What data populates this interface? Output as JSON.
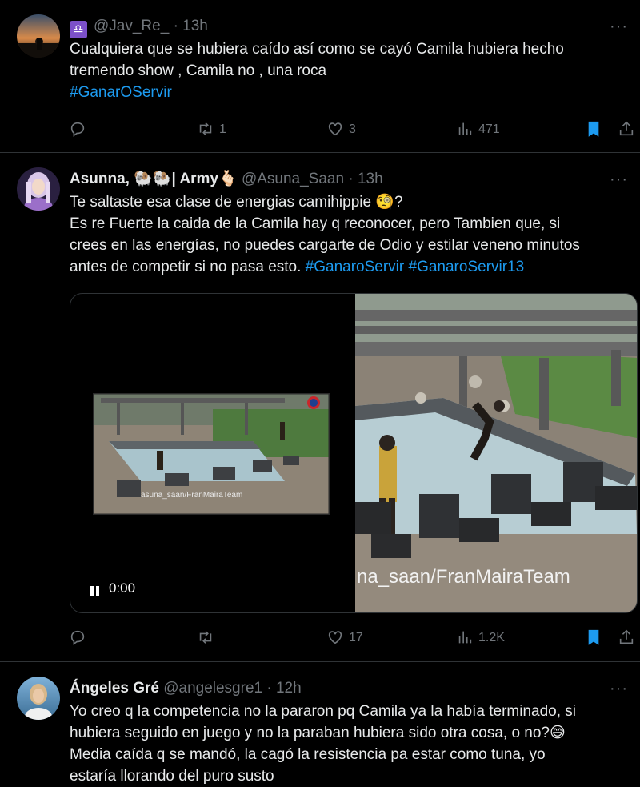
{
  "tweets": [
    {
      "handle": "@Jav_Re_",
      "time": "· 13h",
      "badge": "♎",
      "lines": [
        "Cualquiera que se hubiera caído así como se cayó Camila hubiera hecho",
        "tremendo show , Camila no , una roca"
      ],
      "hashtag": "#GanarOServir",
      "replies": "",
      "retweets": "1",
      "likes": "3",
      "views": "471"
    },
    {
      "name": "Asunna, 🐏🐏| Army🫰🏻",
      "handle": "@Asuna_Saan",
      "time": "· 13h",
      "line1": "Te saltaste esa clase de energias camihippie 🧐?",
      "line2": "Es re Fuerte la caida de la Camila hay q reconocer, pero Tambien que, si",
      "line3": "crees en las energías, no puedes cargarte de Odio y estilar veneno minutos",
      "line4": "antes de competir si no pasa esto.",
      "tag1": "#GanaroServir",
      "tag2": "#GanaroServir13",
      "video_time": "0:00",
      "watermark_small": "asuna_saan/FranMairaTeam",
      "watermark_large": "na_saan/FranMairaTeam",
      "replies": "",
      "retweets": "",
      "likes": "17",
      "views": "1.2K"
    },
    {
      "name": "Ángeles Gré",
      "handle": "@angelesgre1",
      "time": "· 12h",
      "line1": "Yo creo q la competencia no la pararon pq Camila ya la había terminado, si",
      "line2": "hubiera seguido en juego y no la paraban hubiera sido otra cosa, o no?😅",
      "line3": "Media caída q se mandó, la cagó la resistencia pa estar como tuna, yo",
      "line4": "estaría llorando del puro susto"
    }
  ],
  "more_glyph": "···",
  "colors": {
    "accent": "#1d9bf0",
    "muted": "#71767b",
    "background": "#000000",
    "text": "#e7e9ea"
  },
  "icons": [
    "reply-icon",
    "retweet-icon",
    "like-icon",
    "views-icon",
    "bookmark-icon",
    "share-icon",
    "pause-icon"
  ]
}
